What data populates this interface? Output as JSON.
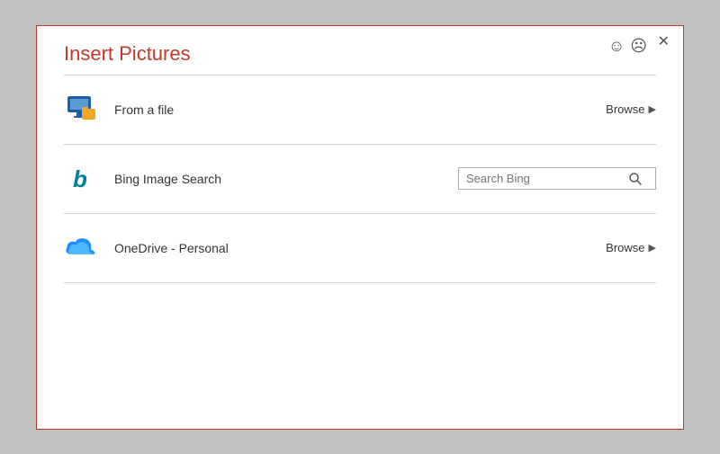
{
  "dialog": {
    "title": "Insert Pictures",
    "close_label": "✕"
  },
  "icons": {
    "happy": "☺",
    "sad": "☹",
    "close": "✕",
    "search": "🔍"
  },
  "rows": [
    {
      "id": "from-file",
      "label": "From a file",
      "action_label": "Browse",
      "action_type": "browse"
    },
    {
      "id": "bing-search",
      "label": "Bing Image Search",
      "action_type": "search",
      "search_placeholder": "Search Bing"
    },
    {
      "id": "onedrive",
      "label": "OneDrive - Personal",
      "action_label": "Browse",
      "action_type": "browse"
    }
  ]
}
